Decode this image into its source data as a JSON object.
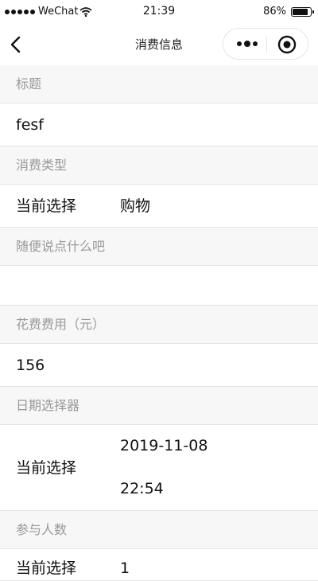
{
  "status_bar": {
    "carrier": "WeChat",
    "time": "21:39",
    "battery": "86%",
    "battery_level": 0.86,
    "icons": [
      "signal-dots-icon",
      "wifi-icon",
      "battery-icon"
    ]
  },
  "nav": {
    "title": "消费信息",
    "icons": [
      "back-chevron-icon",
      "more-dots-icon",
      "close-target-icon"
    ]
  },
  "form": {
    "title_section": "标题",
    "title_value": "fesf",
    "type_section": "消费类型",
    "type_label": "当前选择",
    "type_value": "购物",
    "remark_section": "随便说点什么吧",
    "remark_value": "",
    "cost_section": "花费费用（元）",
    "cost_value": "156",
    "date_section": "日期选择器",
    "date_label": "当前选择",
    "date_value": "2019-11-08",
    "time_value": "22:54",
    "people_section": "参与人数",
    "people_label": "当前选择",
    "people_value": "1"
  }
}
